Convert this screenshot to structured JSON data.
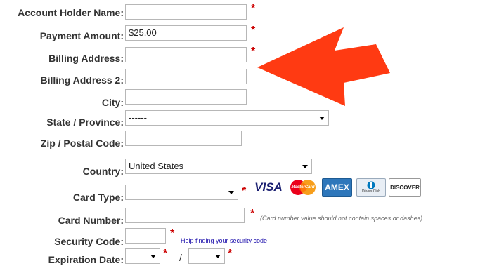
{
  "form": {
    "labels": {
      "account_holder": "Account Holder Name:",
      "payment_amount": "Payment Amount:",
      "billing_address": "Billing Address:",
      "billing_address_2": "Billing Address 2:",
      "city": "City:",
      "state": "State / Province:",
      "zip": "Zip / Postal Code:",
      "country": "Country:",
      "card_type": "Card Type:",
      "card_number": "Card Number:",
      "security_code": "Security Code:",
      "expiration": "Expiration Date:"
    },
    "values": {
      "account_holder": "",
      "payment_amount": "$25.00",
      "billing_address": "",
      "billing_address_2": "",
      "city": "",
      "state": "------",
      "zip": "",
      "country": "United States",
      "card_type": "",
      "card_number": "",
      "security_code": "",
      "exp_month": "",
      "exp_year": ""
    },
    "required_mark": "*",
    "date_separator": "/",
    "card_number_note": "(Card number value should not contain spaces or dashes)",
    "security_help_link": "Help finding your security code",
    "card_logos": {
      "visa": "VISA",
      "mastercard": "MasterCard",
      "amex": "AMEX",
      "diners": "Diners Club",
      "discover": "DISCOVER"
    }
  },
  "annotation": {
    "arrow_color": "#ff3a12"
  },
  "colors": {
    "required": "#cc0000",
    "link": "#1a0dab"
  }
}
